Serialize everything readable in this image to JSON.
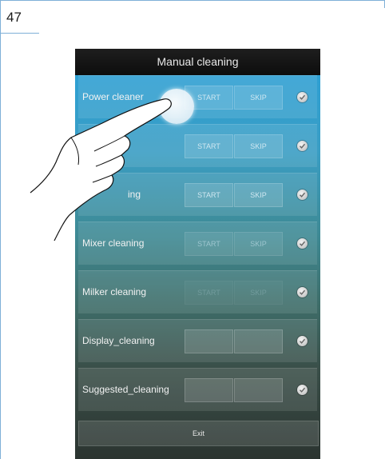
{
  "page": {
    "number": "47"
  },
  "screen": {
    "title": "Manual cleaning",
    "rows": [
      {
        "label": "Power cleaner",
        "start": "START",
        "skip": "SKIP"
      },
      {
        "label": "",
        "start": "START",
        "skip": "SKIP"
      },
      {
        "label": "ing",
        "start": "START",
        "skip": "SKIP"
      },
      {
        "label": "Mixer cleaning",
        "start": "START",
        "skip": "SKIP"
      },
      {
        "label": "Milker cleaning",
        "start": "START",
        "skip": "SKIP"
      },
      {
        "label": "Display_cleaning",
        "start": "",
        "skip": ""
      },
      {
        "label": "Suggested_cleaning",
        "start": "",
        "skip": ""
      }
    ],
    "exit_label": "Exit"
  },
  "icons": {
    "row_status": "check-icon",
    "gesture": "hand-pointer-icon"
  }
}
